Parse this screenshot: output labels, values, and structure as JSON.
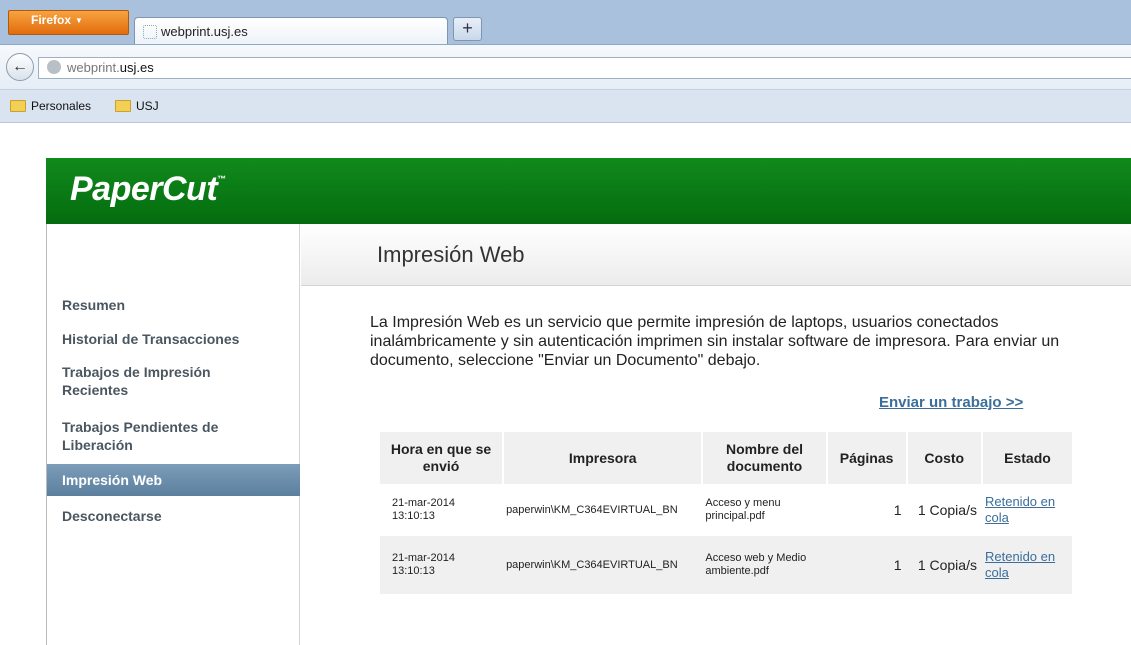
{
  "browser": {
    "menu_label": "Firefox",
    "tab_title": "webprint.usj.es",
    "new_tab": "+",
    "back": "←",
    "url_prefix": "webprint.",
    "url_host": "usj.es",
    "bookmarks": [
      "Personales",
      "USJ"
    ]
  },
  "app": {
    "logo": "PaperCut",
    "logo_tm": "™"
  },
  "sidebar": {
    "items": [
      {
        "label": "Resumen"
      },
      {
        "label": "Historial de Transacciones"
      },
      {
        "label": "Trabajos de Impresión Recientes"
      },
      {
        "label": "Trabajos Pendientes de Liberación"
      },
      {
        "label": "Impresión Web",
        "active": true
      },
      {
        "label": "Desconectarse"
      }
    ]
  },
  "main": {
    "title": "Impresión Web",
    "intro": "La Impresión Web es un servicio que permite impresión de laptops, usuarios conectados inalámbricamente y sin autenticación imprimen sin instalar software de impresora. Para enviar un documento, seleccione \"Enviar un Documento\" debajo.",
    "send_link": "Enviar un trabajo >>",
    "table": {
      "headers": [
        "Hora en que se envió",
        "Impresora",
        "Nombre del documento",
        "Páginas",
        "Costo",
        "Estado"
      ],
      "rows": [
        {
          "time": "21-mar-2014 13:10:13",
          "printer": "paperwin\\KM_C364EVIRTUAL_BN",
          "document": "Acceso y menu principal.pdf",
          "pages": "1",
          "cost": "1 Copia/s",
          "status": "Retenido en cola"
        },
        {
          "time": "21-mar-2014 13:10:13",
          "printer": "paperwin\\KM_C364EVIRTUAL_BN",
          "document": "Acceso web y Medio ambiente.pdf",
          "pages": "1",
          "cost": "1 Copia/s",
          "status": "Retenido en cola"
        }
      ]
    }
  },
  "colors": {
    "header_green": "#0a7d16",
    "active_nav": "#6a8dab",
    "link": "#3b6e9a"
  }
}
